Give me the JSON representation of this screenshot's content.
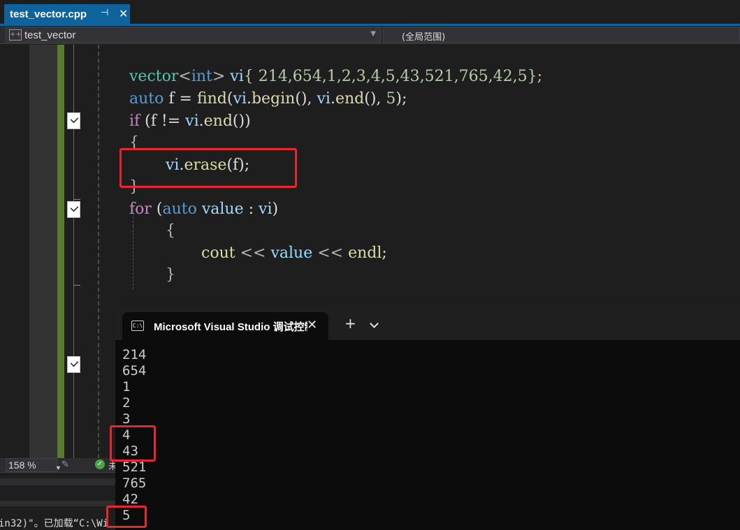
{
  "tab": {
    "title": "test_vector.cpp",
    "pin_glyph": "⊣",
    "close_glyph": "✕"
  },
  "navbar": {
    "project": "test_vector",
    "scope": "(全局范围)"
  },
  "code": {
    "line1": {
      "type": "vector",
      "lt": "<",
      "elem": "int",
      "gt": ">",
      "var": "vi",
      "init": "{ 214,654,1,2,3,4,5,43,521,765,42,5};"
    },
    "line2": {
      "kw": "auto",
      "lhs": " f = ",
      "fn": "find",
      "open": "(",
      "v1": "vi",
      "dot1": ".",
      "begin": "begin",
      "mid": "(), ",
      "v2": "vi",
      "dot2": ".",
      "end": "end",
      "tail": "(), ",
      "num": "5",
      "close": ");"
    },
    "line3": {
      "kw": "if",
      "open": " (f != ",
      "v": "vi",
      "dot": ".",
      "fn": "end",
      "close": "())"
    },
    "line4": "{",
    "line5": {
      "v": "vi",
      "dot": ".",
      "fn": "erase",
      "args": "(f);"
    },
    "line6": "}",
    "line7": {
      "kw": "for",
      "open": " (",
      "kw2": "auto",
      "v": " value",
      "colon": " : ",
      "vi": "vi",
      "close": ")"
    },
    "line8": "{",
    "line9": {
      "fn": "cout",
      "op1": " << ",
      "v": "value",
      "op2": " << ",
      "endl": "endl",
      "semi": ";"
    },
    "line10": "}"
  },
  "status": {
    "zoom": "158 %",
    "zoom_arrow": "▼",
    "ok_glyph": "✓",
    "ok_text": "未"
  },
  "output_panel": {
    "text": "in32)\"。已加载“C:\\Wi"
  },
  "terminal": {
    "title": "Microsoft Visual Studio 调试控制台",
    "icon_text": "C:\\",
    "close_glyph": "✕",
    "plus_glyph": "+",
    "lines": [
      "214",
      "654",
      "1",
      "2",
      "3",
      "4",
      "43",
      "521",
      "765",
      "42",
      "5"
    ]
  },
  "colors": {
    "accent": "#0e639c",
    "highlight_box": "#e8262f",
    "change_bar": "#577a2f"
  }
}
